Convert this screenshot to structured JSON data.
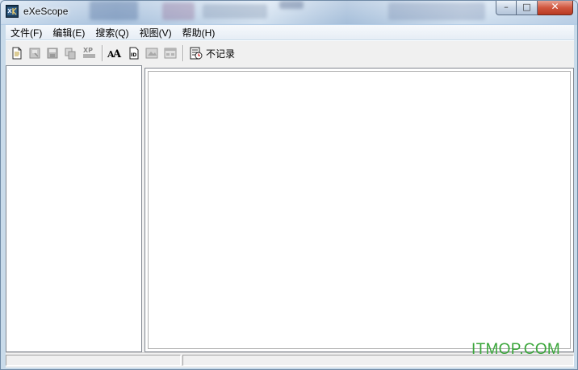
{
  "window": {
    "title": "eXeScope"
  },
  "caption_buttons": {
    "minimize": "–",
    "maximize": "□",
    "close": "✕"
  },
  "menu": [
    {
      "label": "文件(F)"
    },
    {
      "label": "编辑(E)"
    },
    {
      "label": "搜索(Q)"
    },
    {
      "label": "视图(V)"
    },
    {
      "label": "帮助(H)"
    }
  ],
  "toolbar": {
    "icons": [
      "new-document-icon",
      "open-icon",
      "save-icon",
      "copy-icon",
      "xp-icon",
      "font-icon",
      "id-icon",
      "image-icon",
      "dialog-icon",
      "log-icon"
    ],
    "log_label": "不记录"
  },
  "watermark": "ITMOP.COM",
  "colors": {
    "watermark": "#3aa63a",
    "close_button": "#d0563f"
  }
}
